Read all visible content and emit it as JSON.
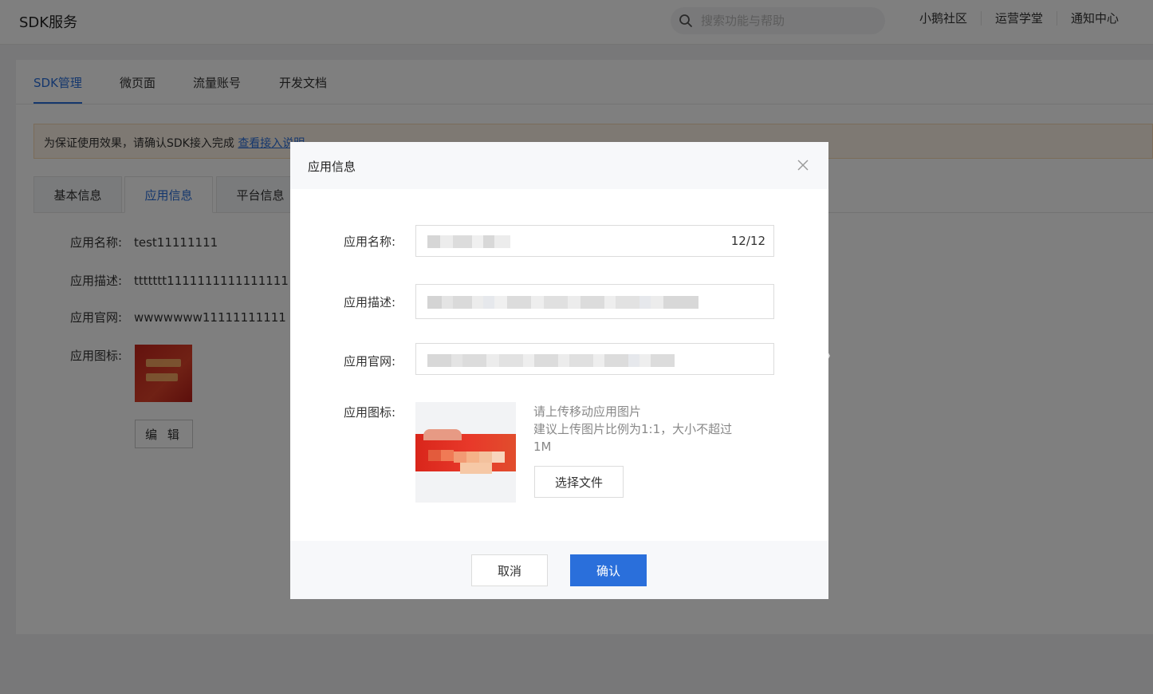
{
  "header": {
    "title": "SDK服务",
    "search_placeholder": "搜索功能与帮助",
    "links": [
      "小鹅社区",
      "运营学堂",
      "通知中心"
    ]
  },
  "tabs": [
    "SDK管理",
    "微页面",
    "流量账号",
    "开发文档"
  ],
  "notice": {
    "text": "为保证使用效果，请确认SDK接入完成",
    "link": "查看接入说明"
  },
  "subtabs": [
    "基本信息",
    "应用信息",
    "平台信息"
  ],
  "info": {
    "name_label": "应用名称:",
    "name_value": "test11111111",
    "desc_label": "应用描述:",
    "desc_value": "ttttttt1111111111111111",
    "site_label": "应用官网:",
    "site_value": "wwwwwww11111111111",
    "icon_label": "应用图标:",
    "edit_label": "编 辑"
  },
  "modal": {
    "title": "应用信息",
    "name_label": "应用名称:",
    "name_counter": "12/12",
    "desc_label": "应用描述:",
    "site_label": "应用官网:",
    "icon_label": "应用图标:",
    "hint_line1": "请上传移动应用图片",
    "hint_line2": "建议上传图片比例为1:1，大小不超过1M",
    "choose_label": "选择文件",
    "cancel_label": "取消",
    "ok_label": "确认"
  },
  "colors": {
    "accent": "#2a6fdb",
    "notice_bg": "#fdf3e7"
  }
}
